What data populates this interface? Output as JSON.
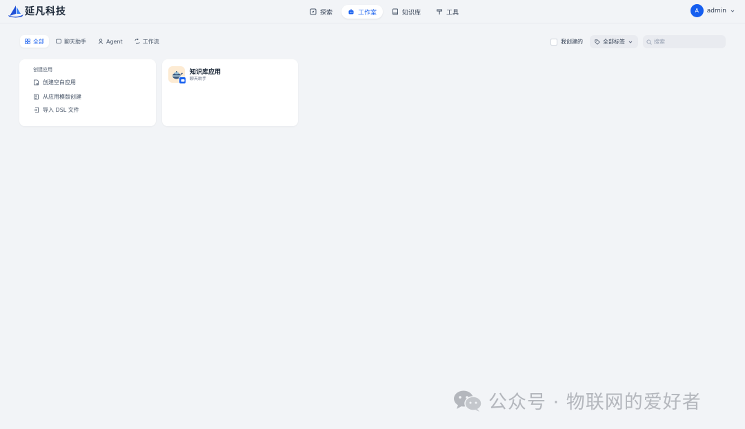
{
  "brand": {
    "name": "延凡科技"
  },
  "nav": {
    "items": [
      {
        "label": "探索",
        "icon": "compass-icon",
        "active": false
      },
      {
        "label": "工作室",
        "icon": "robot-icon",
        "active": true
      },
      {
        "label": "知识库",
        "icon": "book-icon",
        "active": false
      },
      {
        "label": "工具",
        "icon": "hammer-icon",
        "active": false
      }
    ]
  },
  "user": {
    "avatar_letter": "A",
    "name": "admin"
  },
  "filters": {
    "tabs": [
      {
        "label": "全部",
        "icon": "grid-icon",
        "active": true
      },
      {
        "label": "聊天助手",
        "icon": "chat-icon",
        "active": false
      },
      {
        "label": "Agent",
        "icon": "agent-icon",
        "active": false
      },
      {
        "label": "工作流",
        "icon": "workflow-icon",
        "active": false
      }
    ],
    "mine_label": "我创建的",
    "mine_checked": false,
    "tag_label": "全部标签",
    "search_placeholder": "搜索",
    "search_value": ""
  },
  "create": {
    "title": "创建应用",
    "items": [
      {
        "label": "创建空白应用",
        "icon": "file-plus-icon"
      },
      {
        "label": "从应用模版创建",
        "icon": "template-icon"
      },
      {
        "label": "导入 DSL 文件",
        "icon": "import-icon"
      }
    ]
  },
  "apps": [
    {
      "name": "知识库应用",
      "type": "聊天助手",
      "icon": "teapot-icon",
      "badge": "chat-badge-icon"
    }
  ],
  "watermark": {
    "text": "公众号 · 物联网的爱好者",
    "icon": "wechat-icon"
  },
  "colors": {
    "accent": "#155eef",
    "background": "#f2f4f7",
    "app_icon_bg": "#fdebd3"
  }
}
